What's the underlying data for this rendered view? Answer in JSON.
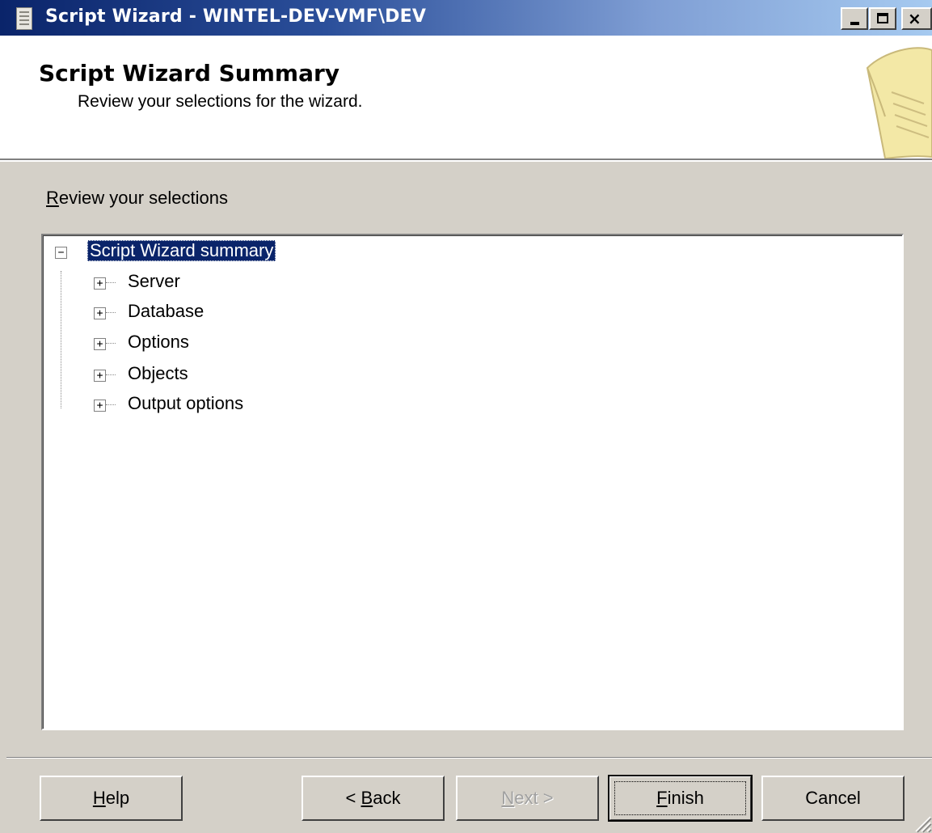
{
  "window": {
    "title": "Script Wizard - WINTEL-DEV-VMF\\DEV",
    "controls": {
      "minimize": "_",
      "maximize": "□",
      "close": "×"
    }
  },
  "header": {
    "title": "Script Wizard Summary",
    "subtitle": "Review your selections for the wizard.",
    "icon": "scroll-icon"
  },
  "review": {
    "label_mnemonic": "R",
    "label_rest": "eview your selections"
  },
  "tree": {
    "root": {
      "label": "Script Wizard summary",
      "expander": "−",
      "selected": true
    },
    "children": [
      {
        "label": "Server",
        "expander": "+"
      },
      {
        "label": "Database",
        "expander": "+"
      },
      {
        "label": "Options",
        "expander": "+"
      },
      {
        "label": "Objects",
        "expander": "+"
      },
      {
        "label": "Output options",
        "expander": "+"
      }
    ]
  },
  "buttons": {
    "help": {
      "mnemonic": "H",
      "rest": "elp"
    },
    "back": {
      "prefix": "< ",
      "mnemonic": "B",
      "rest": "ack"
    },
    "next": {
      "mnemonic": "N",
      "rest": "ext >",
      "disabled": true
    },
    "finish": {
      "mnemonic": "F",
      "rest": "inish",
      "default": true
    },
    "cancel": {
      "label": "Cancel"
    }
  },
  "colors": {
    "dialog_bg": "#d4d0c8",
    "titlebar_start": "#0a246a",
    "titlebar_end": "#a6caf0",
    "selection_bg": "#0a246a",
    "scroll_icon": "#f3e8a6"
  }
}
